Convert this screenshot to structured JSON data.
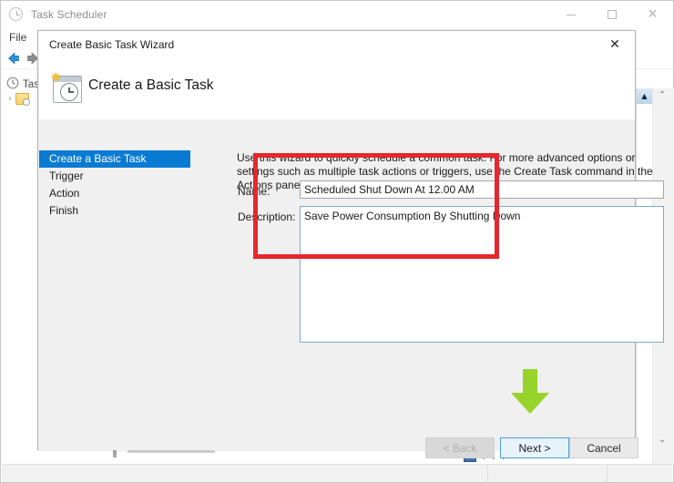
{
  "background_window": {
    "title": "Task Scheduler",
    "title_icon": "clock-icon",
    "caption": {
      "minimize": "–",
      "maximize": "□",
      "close": "✕"
    },
    "menu": [
      "File"
    ],
    "toolbar": {
      "back": "back-arrow-icon",
      "forward": "forward-arrow-icon"
    },
    "tree": {
      "root_label": "Task",
      "root_icon": "clock-icon",
      "child_chevron": "›",
      "child_icon": "task-folder-icon"
    },
    "scrollbars": {
      "up_arrow": "▲",
      "down_arrow": "▲",
      "expand_arrow": "▶",
      "outer_up": "⌃",
      "outer_down": "⌄"
    },
    "bottom_dots": "• • •"
  },
  "dialog": {
    "title": "Create Basic Task Wizard",
    "close_label": "✕",
    "header": {
      "title": "Create a Basic Task",
      "icon": "calendar-clock-star-icon",
      "star": "✷"
    },
    "steps": [
      {
        "label": "Create a Basic Task",
        "active": true
      },
      {
        "label": "Trigger",
        "active": false
      },
      {
        "label": "Action",
        "active": false
      },
      {
        "label": "Finish",
        "active": false
      }
    ],
    "intro_text": "Use this wizard to quickly schedule a common task.  For more advanced options or settings such as multiple task actions or triggers, use the Create Task command in the Actions pane.",
    "fields": {
      "name_label": "Name:",
      "name_value": "Scheduled Shut Down At 12.00 AM",
      "name_placeholder": "",
      "description_label": "Description:",
      "description_value": "Save Power Consumption By Shutting Down",
      "description_placeholder": ""
    },
    "buttons": {
      "back": "< Back",
      "next": "Next >",
      "cancel": "Cancel"
    }
  },
  "annotations": {
    "highlight_rect_color": "#e8262d",
    "arrow_color": "#97d32a",
    "arrow_direction": "down",
    "highlight_target": "name-and-description-fields",
    "arrow_target": "next-button"
  }
}
